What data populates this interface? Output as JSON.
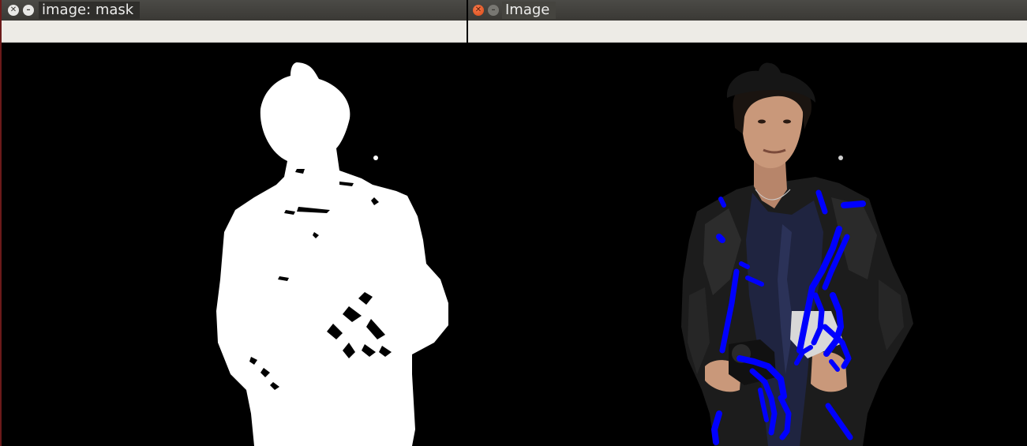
{
  "windows": {
    "mask": {
      "title": "image: mask",
      "close_icon": "close-icon",
      "minimize_icon": "minimize-icon"
    },
    "image": {
      "title": "Image",
      "close_icon": "close-icon",
      "minimize_icon": "minimize-icon"
    }
  },
  "colors": {
    "titlebar": "#3f3e3a",
    "toolbar": "#edebe6",
    "canvas": "#000000",
    "mask_foreground": "#ffffff",
    "scribble": "#0000ff",
    "jacket": "#1c1c1c",
    "sweater": "#1f2440",
    "skin": "#c9987a",
    "hat": "#161616"
  }
}
